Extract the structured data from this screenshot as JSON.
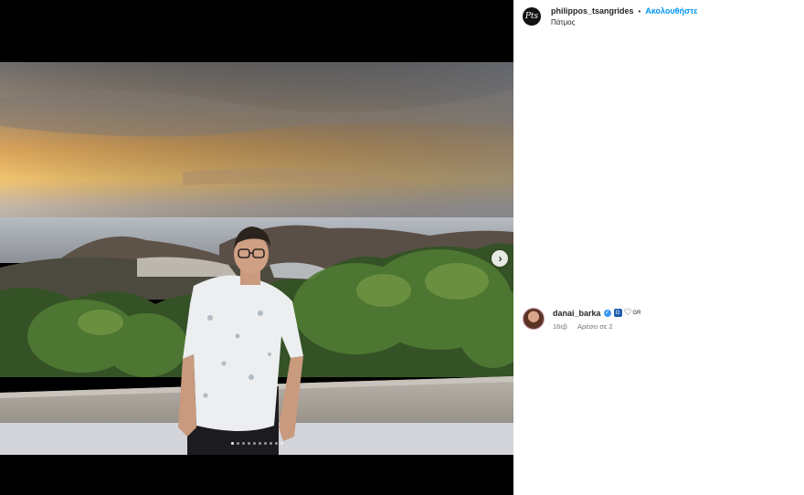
{
  "post": {
    "username": "philippos_tsangrides",
    "separator": "•",
    "follow_label": "Ακολουθήστε",
    "location": "Πάτμος",
    "avatar_initials": "Pts"
  },
  "media": {
    "slide_count": 10,
    "active_slide": 1,
    "next_icon": "chevron-right-icon"
  },
  "comments": [
    {
      "username": "danai_barka",
      "verified_icon": "✓",
      "text_badge": "G",
      "heart_icon": "♡",
      "flag_text": "GR",
      "time": "16εβ",
      "like_label": "Αρέσει σε 2"
    }
  ],
  "colors": {
    "follow": "#0095f6",
    "verified": "#3897f0",
    "background": "#000000"
  }
}
